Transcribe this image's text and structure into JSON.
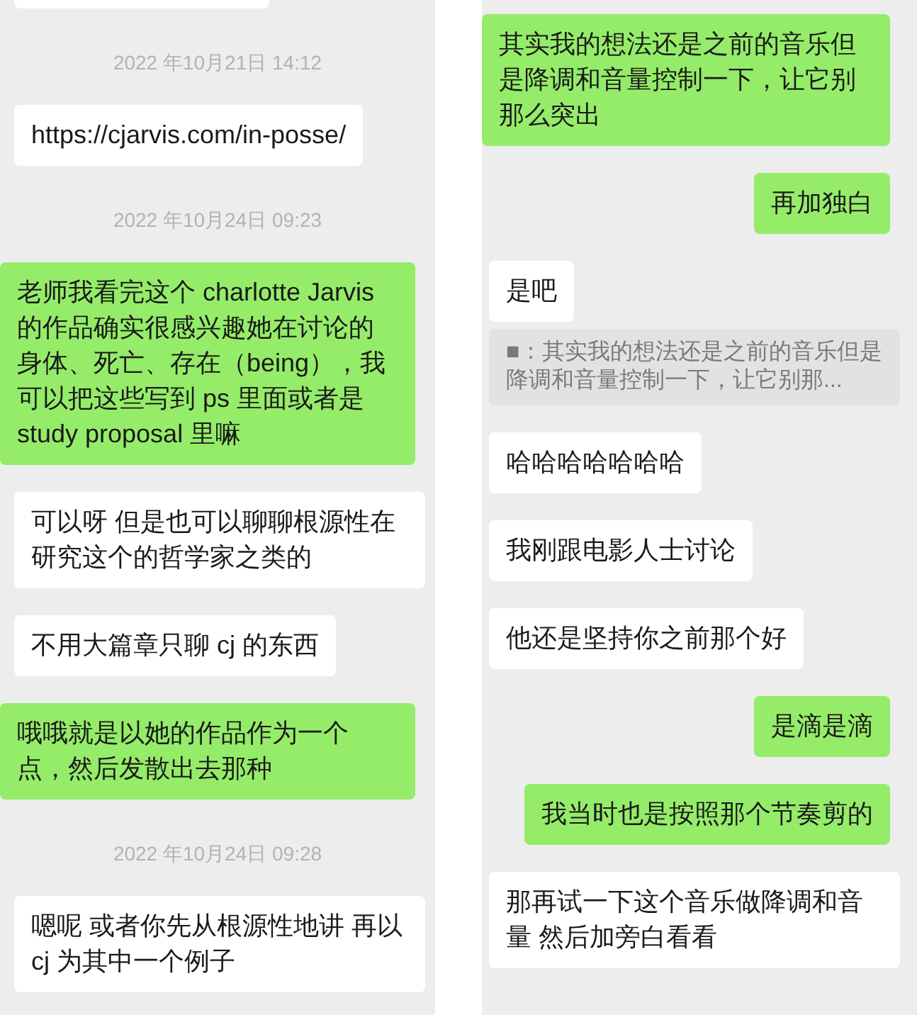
{
  "panels": [
    {
      "items": [
        {
          "kind": "clipped",
          "outgoing": false
        },
        {
          "kind": "time",
          "text": "2022 年10月21日 14:12"
        },
        {
          "kind": "link",
          "outgoing": false,
          "text": "https://cjarvis.com/in-posse/"
        },
        {
          "kind": "time",
          "text": "2022 年10月24日 09:23"
        },
        {
          "kind": "message",
          "outgoing": true,
          "text": "老师我看完这个 charlotte Jarvis 的作品确实很感兴趣她在讨论的身体、死亡、存在（being），我可以把这些写到 ps 里面或者是 study proposal 里嘛"
        },
        {
          "kind": "message",
          "outgoing": false,
          "text": "可以呀 但是也可以聊聊根源性在研究这个的哲学家之类的"
        },
        {
          "kind": "message",
          "outgoing": false,
          "text": "不用大篇章只聊 cj 的东西"
        },
        {
          "kind": "message",
          "outgoing": true,
          "text": "哦哦就是以她的作品作为一个点，然后发散出去那种"
        },
        {
          "kind": "time",
          "text": "2022 年10月24日 09:28"
        },
        {
          "kind": "message",
          "outgoing": false,
          "text": "嗯呢 或者你先从根源性地讲 再以 cj 为其中一个例子"
        }
      ]
    },
    {
      "items": [
        {
          "kind": "message",
          "outgoing": true,
          "text": "其实我的想法还是之前的音乐但是降调和音量控制一下，让它别那么突出"
        },
        {
          "kind": "message",
          "outgoing": true,
          "text": "再加独白"
        },
        {
          "kind": "message",
          "outgoing": false,
          "text": "是吧"
        },
        {
          "kind": "quote",
          "text": "■：其实我的想法还是之前的音乐但是降调和音量控制一下，让它别那..."
        },
        {
          "kind": "message",
          "outgoing": false,
          "text": "哈哈哈哈哈哈哈"
        },
        {
          "kind": "message",
          "outgoing": false,
          "text": "我刚跟电影人士讨论"
        },
        {
          "kind": "message",
          "outgoing": false,
          "text": "他还是坚持你之前那个好"
        },
        {
          "kind": "message",
          "outgoing": true,
          "text": "是滴是滴"
        },
        {
          "kind": "message",
          "outgoing": true,
          "text": "我当时也是按照那个节奏剪的"
        },
        {
          "kind": "message",
          "outgoing": false,
          "text": "那再试一下这个音乐做降调和音量 然后加旁白看看"
        }
      ]
    }
  ]
}
